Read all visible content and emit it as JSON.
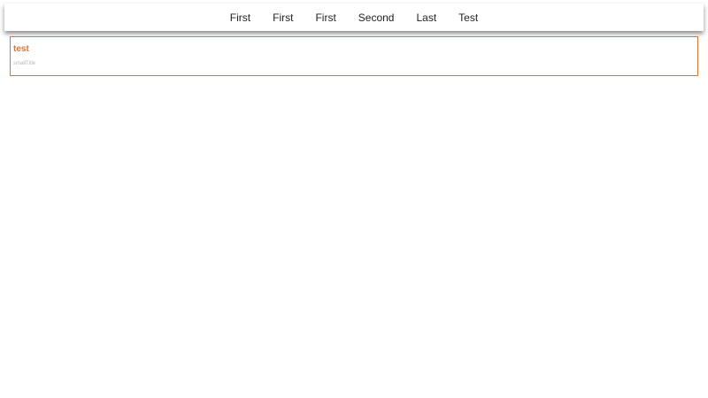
{
  "nav": {
    "items": [
      {
        "label": "First"
      },
      {
        "label": "First"
      },
      {
        "label": "First"
      },
      {
        "label": "Second"
      },
      {
        "label": "Last"
      },
      {
        "label": "Test"
      }
    ]
  },
  "card": {
    "title": "test",
    "subtitle": "smallTitle"
  },
  "colors": {
    "accent": "#d4763a",
    "subtitle": "#b8b8b8",
    "nav_text": "#222222"
  }
}
